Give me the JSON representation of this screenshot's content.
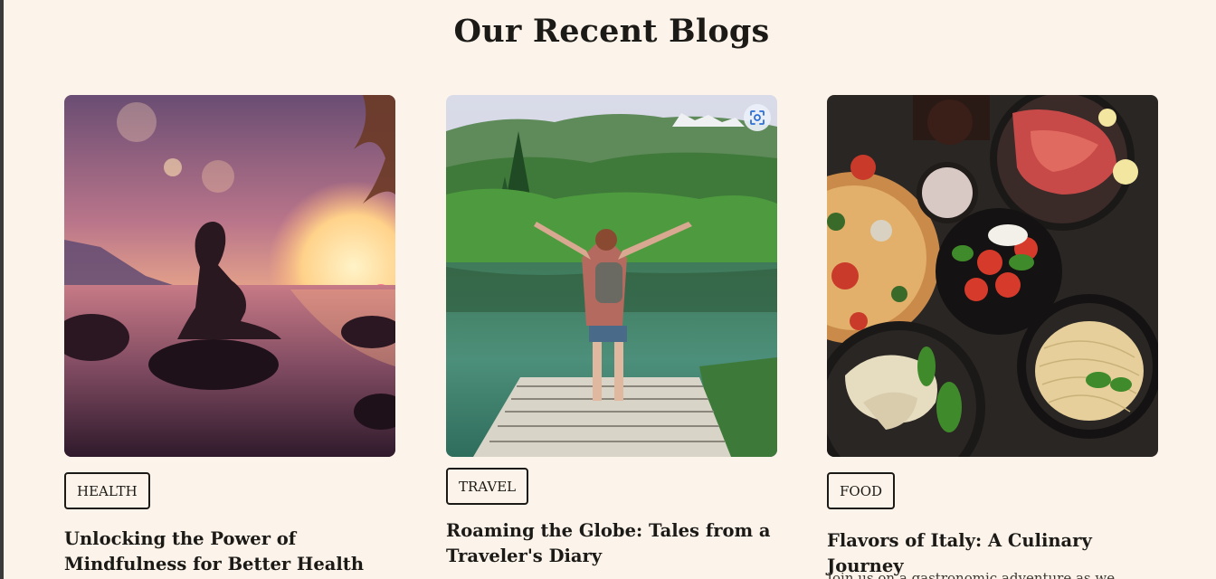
{
  "section": {
    "title": "Our Recent Blogs"
  },
  "cards": [
    {
      "tag": "HEALTH",
      "title": "Unlocking the Power of Mindfulness for Better Health",
      "image_icon": "yoga-sunset-image"
    },
    {
      "tag": "TRAVEL",
      "title": "Roaming the Globe: Tales from a Traveler's Diary",
      "image_icon": "lake-traveler-image",
      "overlay_icon": "visual-search-icon"
    },
    {
      "tag": "FOOD",
      "title": "Flavors of Italy: A Culinary Journey",
      "excerpt": "Join us on a gastronomic adventure as we explore...",
      "image_icon": "italian-food-image"
    }
  ],
  "colors": {
    "background": "#fcf4ea",
    "text": "#1c1a17",
    "frame": "#3a3a3a"
  }
}
